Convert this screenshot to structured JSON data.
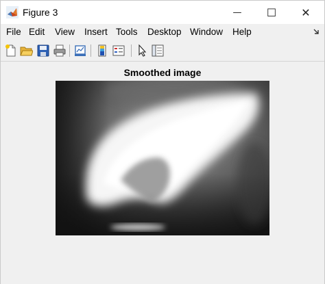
{
  "window": {
    "title": "Figure 3",
    "minimize_glyph": "—",
    "maximize_glyph": "☐",
    "close_glyph": "✕"
  },
  "menubar": {
    "items": [
      "File",
      "Edit",
      "View",
      "Insert",
      "Tools",
      "Desktop",
      "Window",
      "Help"
    ]
  },
  "toolbar": {
    "icons": [
      "new-figure-icon",
      "open-file-icon",
      "save-icon",
      "print-icon",
      "link-plot-icon",
      "insert-colorbar-icon",
      "insert-legend-icon",
      "pointer-icon",
      "property-inspector-icon"
    ]
  },
  "figure": {
    "title": "Smoothed image"
  },
  "colors": {
    "window_bg": "#f0f0f0",
    "titlebar_bg": "#ffffff",
    "image_dark": "#1e1e1e",
    "image_bright": "#ffffff"
  }
}
